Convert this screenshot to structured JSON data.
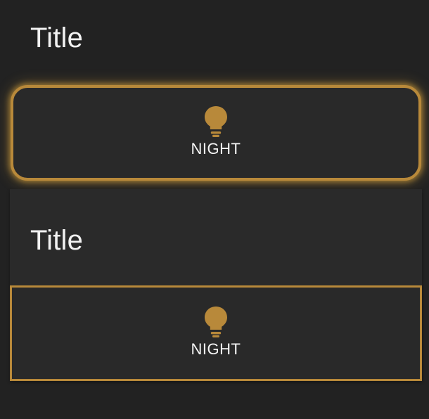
{
  "sections": [
    {
      "title": "Title",
      "button": {
        "icon": "lightbulb-icon",
        "label": "NIGHT"
      }
    },
    {
      "title": "Title",
      "button": {
        "icon": "lightbulb-icon",
        "label": "NIGHT"
      }
    }
  ],
  "colors": {
    "background": "#222222",
    "card": "#292929",
    "accent": "#b8893a",
    "text": "#f2f2f2"
  }
}
